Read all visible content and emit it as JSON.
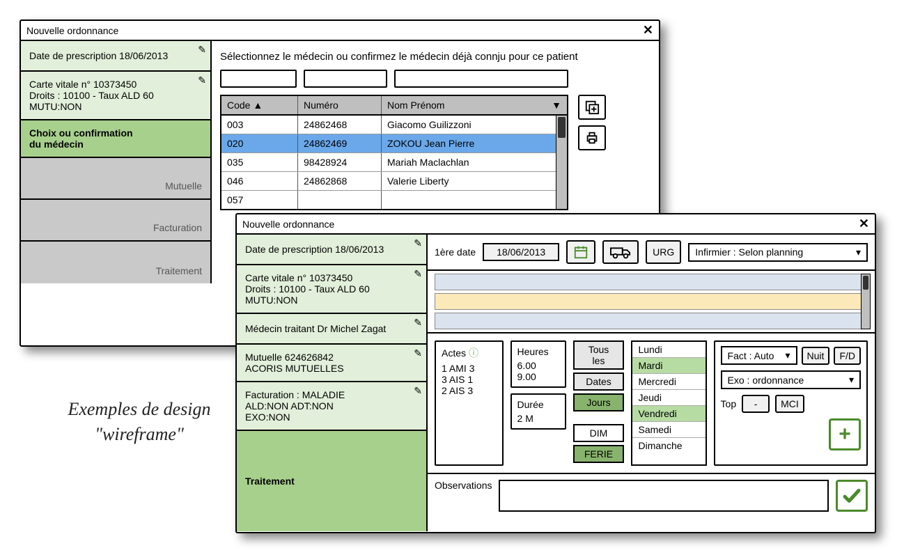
{
  "caption": "Exemples de design \"wireframe\"",
  "window1": {
    "title": "Nouvelle ordonnance",
    "instruction": "Sélectionnez le médecin ou confirmez le médecin déjà connju pour ce patient",
    "steps": {
      "prescription": "Date de prescription  18/06/2013",
      "vitale_line1": "Carte vitale n° 10373450",
      "vitale_line2": "Droits : 10100 - Taux ALD 60",
      "vitale_line3": "MUTU:NON",
      "choix_line1": "Choix ou confirmation",
      "choix_line2": "du médecin",
      "mutuelle": "Mutuelle",
      "facturation": "Facturation",
      "traitement": "Traitement"
    },
    "table": {
      "headers": {
        "code": "Code",
        "numero": "Numéro",
        "nom": "Nom Prénom"
      },
      "rows": [
        {
          "code": "003",
          "numero": "24862468",
          "nom": "Giacomo Guilizzoni",
          "selected": false
        },
        {
          "code": "020",
          "numero": "24862469",
          "nom": "ZOKOU Jean Pierre",
          "selected": true
        },
        {
          "code": "035",
          "numero": "98428924",
          "nom": "Mariah Maclachlan",
          "selected": false
        },
        {
          "code": "046",
          "numero": "24862868",
          "nom": "Valerie Liberty",
          "selected": false
        },
        {
          "code": "057",
          "numero": "",
          "nom": "",
          "selected": false
        }
      ]
    }
  },
  "window2": {
    "title": "Nouvelle ordonnance",
    "steps": {
      "prescription": "Date de prescription 18/06/2013",
      "vitale_line1": "Carte vitale n° 10373450",
      "vitale_line2": "Droits : 10100 - Taux ALD 60",
      "vitale_line3": "MUTU:NON",
      "medecin": "Médecin traitant Dr Michel Zagat",
      "mutuelle_line1": "Mutuelle 624626842",
      "mutuelle_line2": "ACORIS MUTUELLES",
      "fact_line1": "Facturation : MALADIE",
      "fact_line2": "ALD:NON   ADT:NON",
      "fact_line3": "EXO:NON",
      "traitement": "Traitement"
    },
    "topbar": {
      "first_date_label": "1ère date",
      "date_value": "18/06/2013",
      "urg": "URG",
      "planning_select": "Infirmier : Selon planning"
    },
    "actes": {
      "title": "Actes",
      "items": [
        "1 AMI 3",
        "3 AIS 1",
        "2 AIS 3"
      ]
    },
    "heures": {
      "title": "Heures",
      "items": [
        "6.00",
        "9.00"
      ]
    },
    "duree": {
      "title": "Durée",
      "value": "2 M"
    },
    "freq": {
      "tous_les": "Tous les",
      "dates": "Dates",
      "jours": "Jours",
      "dim": "DIM",
      "ferie": "FERIE"
    },
    "days": {
      "lundi": "Lundi",
      "mardi": "Mardi",
      "mercredi": "Mercredi",
      "jeudi": "Jeudi",
      "vendredi": "Vendredi",
      "samedi": "Samedi",
      "dimanche": "Dimanche"
    },
    "right": {
      "fact_select": "Fact : Auto",
      "nuit": "Nuit",
      "fd": "F/D",
      "exo_select": "Exo : ordonnance",
      "top_label": "Top",
      "top_value": "-",
      "mci": "MCI"
    },
    "observations_label": "Observations"
  }
}
